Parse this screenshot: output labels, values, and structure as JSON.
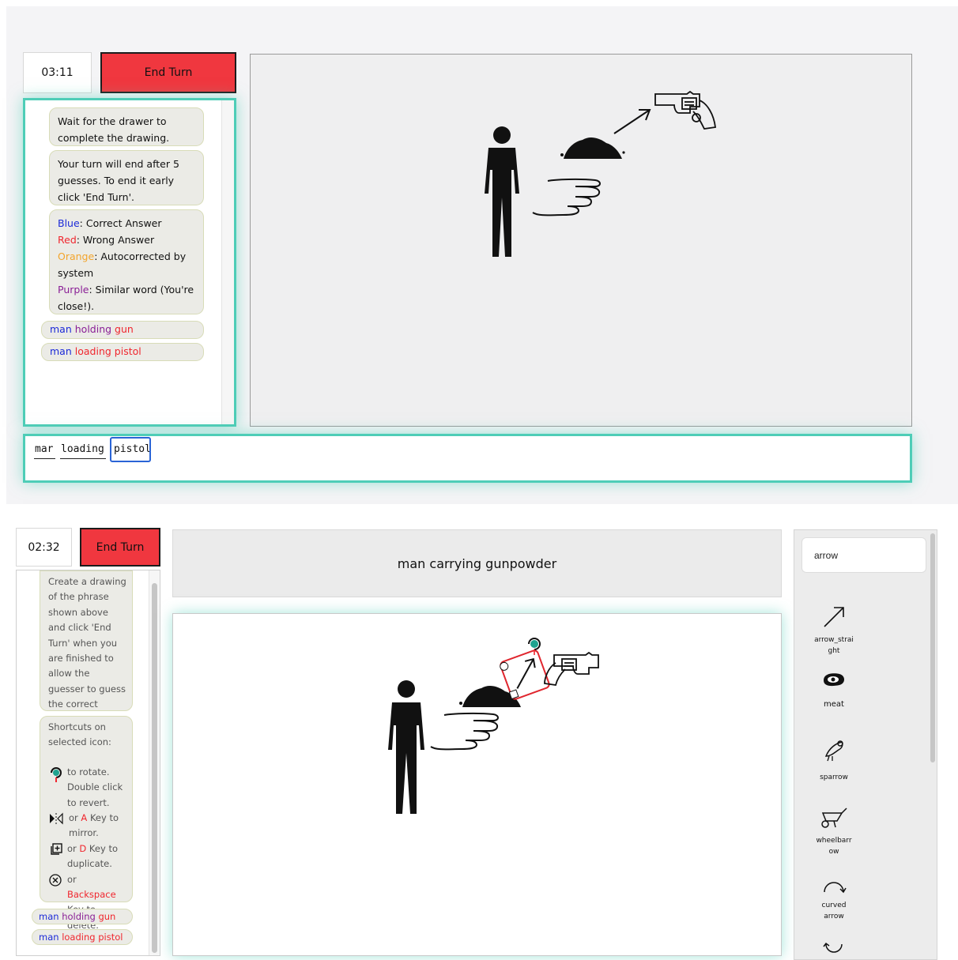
{
  "guesser": {
    "timer": "03:11",
    "end_turn_label": "End Turn",
    "messages": {
      "wait": "Wait for the drawer to complete the drawing.",
      "turn_end": "Your turn will end after 5 guesses. To end it early click 'End Turn'.",
      "legend": {
        "blue_word": "Blue",
        "blue_text": ": Correct Answer",
        "red_word": "Red",
        "red_text": ": Wrong Answer",
        "orange_word": "Orange",
        "orange_text": ": Autocorrected by system",
        "purple_word": "Purple",
        "purple_text": ": Similar word (You're close!)."
      }
    },
    "guesses": [
      {
        "w1": "man",
        "w2": "holding",
        "w3": "gun",
        "colors": [
          "#1c2ad8",
          "#8a1f96",
          "#f0262e"
        ]
      },
      {
        "w1": "man",
        "w2": "loading",
        "w3": "pistol",
        "colors": [
          "#1c2ad8",
          "#f0262e",
          "#f0262e"
        ]
      }
    ],
    "input_words": [
      "mar",
      "loading",
      "pistol"
    ]
  },
  "drawer": {
    "timer": "02:32",
    "end_turn_label": "End Turn",
    "phrase": "man carrying gunpowder",
    "instructions": "Create a drawing of the phrase shown above and click 'End Turn' when you are finished to allow the guesser to guess the correct answer.",
    "shortcuts": {
      "heading": "Shortcuts on selected icon:",
      "rotate": "to rotate. Double click to revert.",
      "mirror_pre": "or ",
      "mirror_key": "A",
      "mirror_post": " Key to mirror.",
      "dup_pre": "or ",
      "dup_key": "D",
      "dup_post": " Key to duplicate.",
      "del_pre": "or ",
      "del_key": "Backspace",
      "del_post": " Key to delete."
    },
    "guesses": [
      {
        "w1": "man",
        "w2": "holding",
        "w3": "gun"
      },
      {
        "w1": "man",
        "w2": "loading",
        "w3": "pistol"
      }
    ],
    "icon_search_value": "arrow",
    "icons": [
      {
        "name": "arrow-straight-icon",
        "label": "arrow_straight"
      },
      {
        "name": "meat-icon",
        "label": "meat"
      },
      {
        "name": "sparrow-icon",
        "label": "sparrow"
      },
      {
        "name": "wheelbarrow-icon",
        "label": "wheelbarrow"
      },
      {
        "name": "curved-arrow-icon",
        "label": "curved arrow"
      }
    ]
  },
  "colors": {
    "accent_teal": "#4ecdb7",
    "end_turn_red": "#f0373f",
    "correct_blue": "#1c2ad8",
    "wrong_red": "#f0262e",
    "autocorrect_orange": "#f3a42b",
    "similar_purple": "#8a1f96"
  }
}
